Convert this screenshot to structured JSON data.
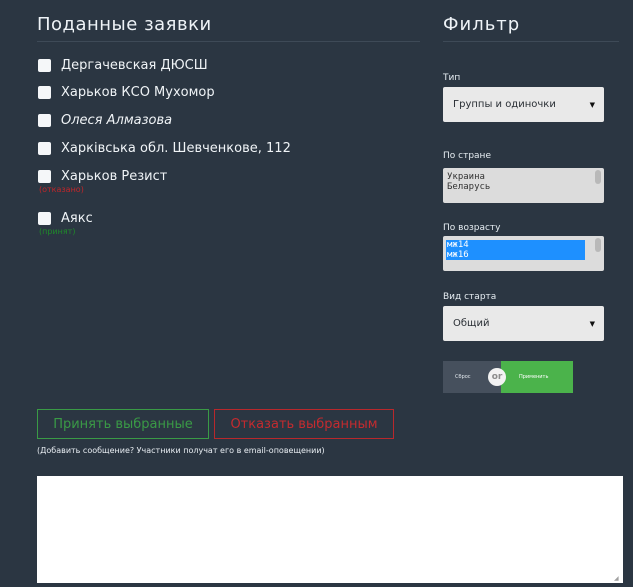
{
  "applications": {
    "title": "Поданные заявки",
    "items": [
      {
        "label": "Дергачевская ДЮСШ"
      },
      {
        "label": "Харьков КСО Мухомор"
      },
      {
        "label": "Олеся Алмазова"
      },
      {
        "label": "Харківська обл. Шевченкове, 112"
      },
      {
        "label": "Харьков Резист",
        "status": "(отказано)"
      },
      {
        "label": "Аякс",
        "status": "(принят)"
      }
    ]
  },
  "filter": {
    "title": "Фильтр",
    "type_label": "Тип",
    "type_value": "Группы и одиночки",
    "country_label": "По стране",
    "countries": [
      "Украина",
      "Беларусь"
    ],
    "age_label": "По возрасту",
    "ages": [
      "мж14",
      "мж16"
    ],
    "start_label": "Вид старта",
    "start_value": "Общий",
    "reset_label": "Сброс",
    "or_label": "or",
    "apply_label": "Применить"
  },
  "actions": {
    "accept_label": "Принять выбранные",
    "reject_label": "Отказать выбранным",
    "hint": "(Добавить сообщение? Участники получат его в email-оповещении)"
  },
  "colors": {
    "background": "#2b3642",
    "accept": "#3a9a46",
    "reject": "#c42b2f",
    "apply": "#4bb34b",
    "selected_option": "#1e90ff"
  }
}
